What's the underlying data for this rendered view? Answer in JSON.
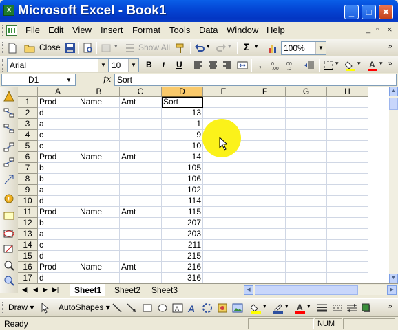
{
  "window": {
    "title": "Microsoft Excel - Book1",
    "app_icon": "X",
    "minimize": "_",
    "maximize": "□",
    "close": "✕"
  },
  "menu": {
    "items": [
      "File",
      "Edit",
      "View",
      "Insert",
      "Format",
      "Tools",
      "Data",
      "Window",
      "Help"
    ],
    "mdi_minimize": "_",
    "mdi_restore": "▫",
    "mdi_close": "×"
  },
  "standard_toolbar": {
    "close_label": "Close",
    "show_all_label": "Show All",
    "sum_label": "Σ",
    "zoom": "100%"
  },
  "format_toolbar": {
    "font": "Arial",
    "font_size": "10",
    "bold": "B",
    "italic": "I",
    "underline": "U",
    "comma": ",",
    "accent_fill": "#ffff00",
    "accent_font": "#ff0000"
  },
  "formula_bar": {
    "name_box": "D1",
    "fx": "fx",
    "content": "Sort"
  },
  "grid": {
    "columns": [
      "A",
      "B",
      "C",
      "D",
      "E",
      "F",
      "G",
      "H"
    ],
    "selected_column": "D",
    "rows": [
      {
        "n": "1",
        "A": "Prod",
        "B": "Name",
        "C": "Amt",
        "D": "Sort"
      },
      {
        "n": "2",
        "A": "d",
        "B": "",
        "C": "",
        "D": "13"
      },
      {
        "n": "3",
        "A": "a",
        "B": "",
        "C": "",
        "D": "1"
      },
      {
        "n": "4",
        "A": "c",
        "B": "",
        "C": "",
        "D": "9"
      },
      {
        "n": "5",
        "A": "c",
        "B": "",
        "C": "",
        "D": "10"
      },
      {
        "n": "6",
        "A": "Prod",
        "B": "Name",
        "C": "Amt",
        "D": "14"
      },
      {
        "n": "7",
        "A": "b",
        "B": "",
        "C": "",
        "D": "105"
      },
      {
        "n": "8",
        "A": "b",
        "B": "",
        "C": "",
        "D": "106"
      },
      {
        "n": "9",
        "A": "a",
        "B": "",
        "C": "",
        "D": "102"
      },
      {
        "n": "10",
        "A": "d",
        "B": "",
        "C": "",
        "D": "114"
      },
      {
        "n": "11",
        "A": "Prod",
        "B": "Name",
        "C": "Amt",
        "D": "115"
      },
      {
        "n": "12",
        "A": "b",
        "B": "",
        "C": "",
        "D": "207"
      },
      {
        "n": "13",
        "A": "a",
        "B": "",
        "C": "",
        "D": "203"
      },
      {
        "n": "14",
        "A": "c",
        "B": "",
        "C": "",
        "D": "211"
      },
      {
        "n": "15",
        "A": "d",
        "B": "",
        "C": "",
        "D": "215"
      },
      {
        "n": "16",
        "A": "Prod",
        "B": "Name",
        "C": "Amt",
        "D": "216"
      },
      {
        "n": "17",
        "A": "d",
        "B": "",
        "C": "",
        "D": "316"
      }
    ]
  },
  "sheets": {
    "tabs": [
      "Sheet1",
      "Sheet2",
      "Sheet3"
    ],
    "active": "Sheet1"
  },
  "drawing_toolbar": {
    "draw_label": "Draw",
    "autoshapes_label": "AutoShapes"
  },
  "status": {
    "text": "Ready",
    "num": "NUM"
  },
  "colors": {
    "title_bar": "#0a5fe8",
    "cursor_highlight": "#fbf21a",
    "selected_header": "#f9c96b"
  }
}
